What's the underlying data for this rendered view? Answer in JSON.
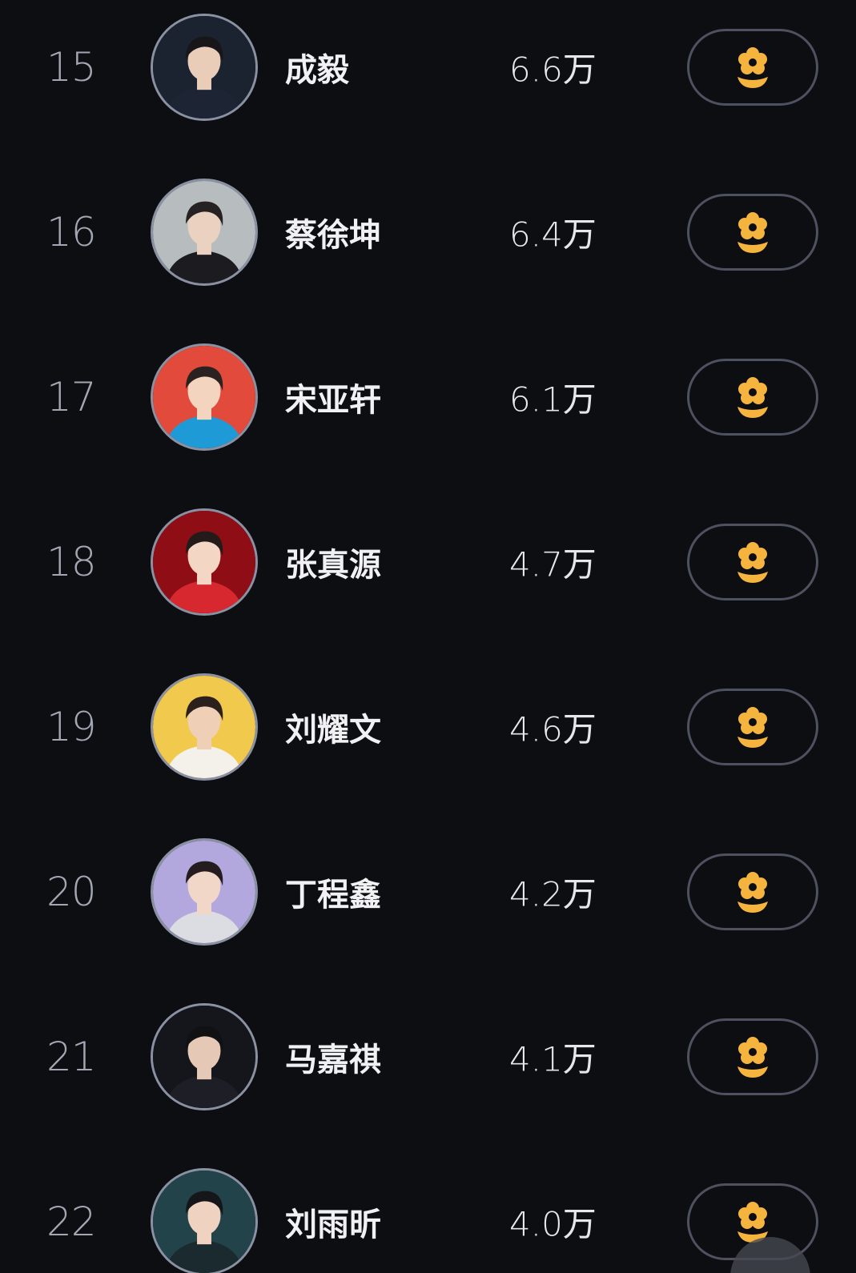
{
  "ranking": {
    "rows": [
      {
        "rank": "15",
        "name": "成毅",
        "score": "6.6万",
        "avatar": {
          "bg": "#1c2330",
          "skin": "#e9cdb8",
          "hair": "#17171a",
          "cloth": "#1d2434"
        }
      },
      {
        "rank": "16",
        "name": "蔡徐坤",
        "score": "6.4万",
        "avatar": {
          "bg": "#b7bdbf",
          "skin": "#ebd2c0",
          "hair": "#262224",
          "cloth": "#1c1c20"
        }
      },
      {
        "rank": "17",
        "name": "宋亚轩",
        "score": "6.1万",
        "avatar": {
          "bg": "#e24b3b",
          "skin": "#f2d4bf",
          "hair": "#2a2220",
          "cloth": "#1e9bd7"
        }
      },
      {
        "rank": "18",
        "name": "张真源",
        "score": "4.7万",
        "avatar": {
          "bg": "#8f0e16",
          "skin": "#f3d6c4",
          "hair": "#231a1a",
          "cloth": "#d7272f"
        }
      },
      {
        "rank": "19",
        "name": "刘耀文",
        "score": "4.6万",
        "avatar": {
          "bg": "#f1c94d",
          "skin": "#efcfb6",
          "hair": "#2b201b",
          "cloth": "#f4f1ea"
        }
      },
      {
        "rank": "20",
        "name": "丁程鑫",
        "score": "4.2万",
        "avatar": {
          "bg": "#b2a8dd",
          "skin": "#f1d7c8",
          "hair": "#241c1e",
          "cloth": "#dcdde3"
        }
      },
      {
        "rank": "21",
        "name": "马嘉祺",
        "score": "4.1万",
        "avatar": {
          "bg": "#15161c",
          "skin": "#e6c8b6",
          "hair": "#111114",
          "cloth": "#1d1e26"
        }
      },
      {
        "rank": "22",
        "name": "刘雨昕",
        "score": "4.0万",
        "avatar": {
          "bg": "#23434a",
          "skin": "#f0d2c0",
          "hair": "#141619",
          "cloth": "#1a2a2e"
        }
      }
    ]
  },
  "colors": {
    "background": "#0d0e11",
    "flower_icon": "#f4b43d",
    "button_border": "#4d5160",
    "rank_text": "#a3a7b3"
  },
  "icons": {
    "gift": "flower-icon"
  }
}
